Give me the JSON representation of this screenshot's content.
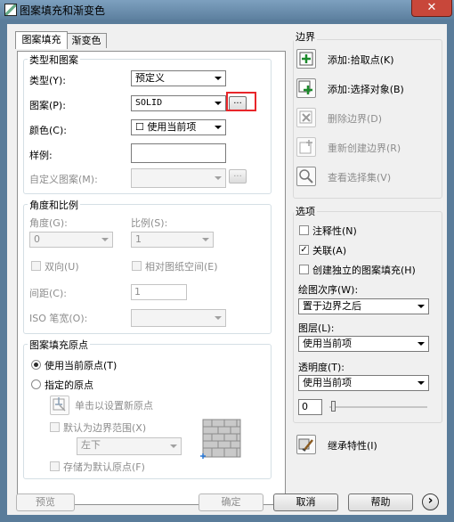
{
  "window": {
    "title": "图案填充和渐变色",
    "close_glyph": "✕"
  },
  "tabs": [
    {
      "label": "图案填充"
    },
    {
      "label": "渐变色"
    }
  ],
  "type_pattern": {
    "group_label": "类型和图案",
    "type_label": "类型(Y):",
    "type_value": "预定义",
    "pattern_label": "图案(P):",
    "pattern_value": "SOLID",
    "pattern_browse": "...",
    "color_label": "颜色(C):",
    "color_value": "☐ 使用当前项",
    "swatch_label": "样例:",
    "custom_label": "自定义图案(M):",
    "custom_browse": "..."
  },
  "angle_scale": {
    "group_label": "角度和比例",
    "angle_label": "角度(G):",
    "angle_value": "0",
    "scale_label": "比例(S):",
    "scale_value": "1",
    "double_label": "双向(U)",
    "relative_label": "相对图纸空间(E)",
    "spacing_label": "间距(C):",
    "spacing_value": "1",
    "iso_label": "ISO 笔宽(O):"
  },
  "origin": {
    "group_label": "图案填充原点",
    "use_current_label": "使用当前原点(T)",
    "specified_label": "指定的原点",
    "click_set_label": "单击以设置新原点",
    "default_boundary_label": "默认为边界范围(X)",
    "position_value": "左下",
    "store_default_label": "存储为默认原点(F)"
  },
  "boundary": {
    "group_label": "边界",
    "add_pick_label": "添加:拾取点(K)",
    "add_select_label": "添加:选择对象(B)",
    "remove_label": "删除边界(D)",
    "recreate_label": "重新创建边界(R)",
    "view_label": "查看选择集(V)"
  },
  "options": {
    "group_label": "选项",
    "annotative_label": "注释性(N)",
    "associative_label": "关联(A)",
    "associative_checked": true,
    "separate_label": "创建独立的图案填充(H)",
    "draw_order_label": "绘图次序(W):",
    "draw_order_value": "置于边界之后",
    "layer_label": "图层(L):",
    "layer_value": "使用当前项",
    "transparency_label": "透明度(T):",
    "transparency_value": "使用当前项",
    "transparency_number": "0"
  },
  "inherit_label": "继承特性(I)",
  "footer": {
    "preview": "预览",
    "ok": "确定",
    "cancel": "取消",
    "help": "帮助",
    "more_glyph": "›"
  },
  "colors": {
    "title_bar": "#6b8eaf",
    "close_button": "#c8473a",
    "highlight_box": "#e8262a",
    "dialog_bg": "#f0f0f0"
  }
}
